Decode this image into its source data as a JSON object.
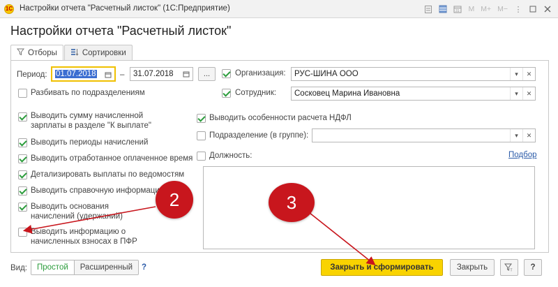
{
  "window": {
    "title": "Настройки отчета \"Расчетный листок\"  (1С:Предприятие)",
    "app_logo_text": "1С",
    "controls": [
      "M",
      "M+",
      "M−"
    ]
  },
  "form": {
    "title": "Настройки отчета \"Расчетный листок\""
  },
  "tabs": [
    {
      "label": "Отборы",
      "icon": "filter-icon",
      "active": true
    },
    {
      "label": "Сортировки",
      "icon": "sort-icon",
      "active": false
    }
  ],
  "period": {
    "label": "Период:",
    "from": "01.07.2018",
    "dash": "–",
    "to": "31.07.2018",
    "more_label": "..."
  },
  "split_by_division": {
    "label": "Разбивать по подразделениям",
    "checked": false
  },
  "organization": {
    "label": "Организация:",
    "value": "РУС-ШИНА ООО",
    "checked": true
  },
  "employee": {
    "label": "Сотрудник:",
    "value": "Сосковец Марина Ивановна",
    "checked": true
  },
  "left_options": [
    {
      "label": "Выводить сумму начисленной зарплаты в разделе \"К выплате\"",
      "checked": true
    },
    {
      "label": "Выводить периоды начислений",
      "checked": true
    },
    {
      "label": "Выводить отработанное оплаченное время",
      "checked": true
    },
    {
      "label": "Детализировать выплаты по ведомостям",
      "checked": true
    },
    {
      "label": "Выводить справочную информацию",
      "checked": true
    },
    {
      "label": "Выводить основания начислений (удержаний)",
      "checked": true
    },
    {
      "label": "Выводить информацию о начисленных взносах в ПФР",
      "checked": false
    }
  ],
  "ndfl": {
    "label": "Выводить особенности расчета НДФЛ",
    "checked": true
  },
  "division": {
    "label": "Подразделение (в группе):",
    "value": "",
    "checked": false
  },
  "position": {
    "label": "Должность:",
    "checked": false,
    "pick_link": "Подбор"
  },
  "view": {
    "label": "Вид:",
    "simple": "Простой",
    "extended": "Расширенный",
    "help": "?"
  },
  "buttons": {
    "close_and_build": "Закрыть и сформировать",
    "close": "Закрыть",
    "help": "?"
  },
  "annotations": {
    "marker_2": "2",
    "marker_3": "3"
  },
  "colors": {
    "primary_button": "#f9d300",
    "checkbox_check": "#2c9c3c",
    "marker": "#c8161d",
    "selection": "#3b6dd1",
    "focus_border": "#f0c000"
  }
}
